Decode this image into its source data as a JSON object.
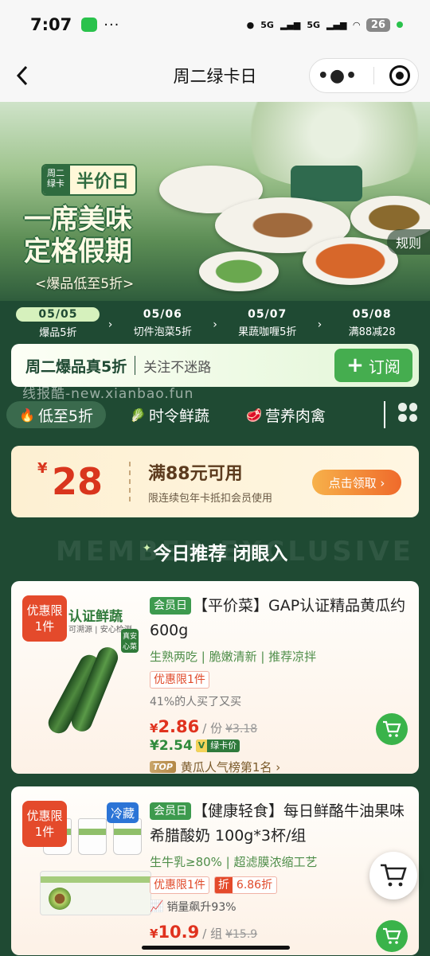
{
  "status_bar": {
    "time": "7:07",
    "signal1": "5G",
    "signal2": "5G",
    "battery": "26"
  },
  "nav": {
    "title": "周二绿卡日"
  },
  "banner": {
    "tag_left": "周二绿卡",
    "tag_right": "半价日",
    "slogan_line1": "一席美味",
    "slogan_line2": "定格假期",
    "subtitle": "<爆品低至5折>",
    "rules": "规则"
  },
  "date_tabs": [
    {
      "date": "05/05",
      "label": "爆品5折"
    },
    {
      "date": "05/06",
      "label": "切件泡菜5折"
    },
    {
      "date": "05/07",
      "label": "果蔬咖喱5折"
    },
    {
      "date": "05/08",
      "label": "满88减28"
    }
  ],
  "subscribe": {
    "main": "周二爆品真5折",
    "desc": "关注不迷路",
    "button": "订阅"
  },
  "watermark": "线报酷-new.xianbao.fun",
  "category_tabs": [
    {
      "icon": "🔥",
      "label": "低至5折"
    },
    {
      "icon": "🥬",
      "label": "时令鲜蔬"
    },
    {
      "icon": "🥩",
      "label": "营养肉禽"
    }
  ],
  "coupon": {
    "currency": "¥",
    "amount": "28",
    "title": "满88元可用",
    "desc": "限连续包年卡抵扣会员使用",
    "button": "点击领取 ›"
  },
  "section": {
    "title": "今日推荐 闭眼入",
    "bg_text": "MEMBER EXCLUSIVE"
  },
  "products": [
    {
      "limit_tag_line1": "优惠限",
      "limit_tag_line2": "1件",
      "image_text": "认证鲜蔬",
      "image_subtext": "可溯源 | 安心检测",
      "image_badge": "真安心菜",
      "member_tag": "会员日",
      "title": "【平价菜】GAP认证精品黄瓜约600g",
      "features": "生熟两吃 | 脆嫩清新 | 推荐凉拌",
      "limit_chip": "优惠限1件",
      "bought": "41%的人买了又买",
      "price_symbol": "¥",
      "price": "2.86",
      "unit": "/ 份",
      "original_price": "¥3.18",
      "member_price": "¥2.54",
      "green_card_v": "V",
      "green_card_label": "绿卡价",
      "rank_badge": "TOP",
      "rank_text": "黄瓜人气榜第1名 ›"
    },
    {
      "limit_tag_line1": "优惠限",
      "limit_tag_line2": "1件",
      "cold_tag": "冷藏",
      "member_tag": "会员日",
      "title": "【健康轻食】每日鲜酪牛油果味希腊酸奶 100g*3杯/组",
      "features": "生牛乳≥80% | 超滤膜浓缩工艺",
      "limit_chip": "优惠限1件",
      "discount_z": "折",
      "discount_value": "6.86折",
      "sales": "销量飙升93%",
      "price_symbol": "¥",
      "price": "10.9",
      "unit": "/ 组",
      "original_price": "¥15.9"
    }
  ],
  "colors": {
    "accent_green": "#3ab34a",
    "deep_green": "#1f4a33",
    "price_red": "#e0321e"
  }
}
